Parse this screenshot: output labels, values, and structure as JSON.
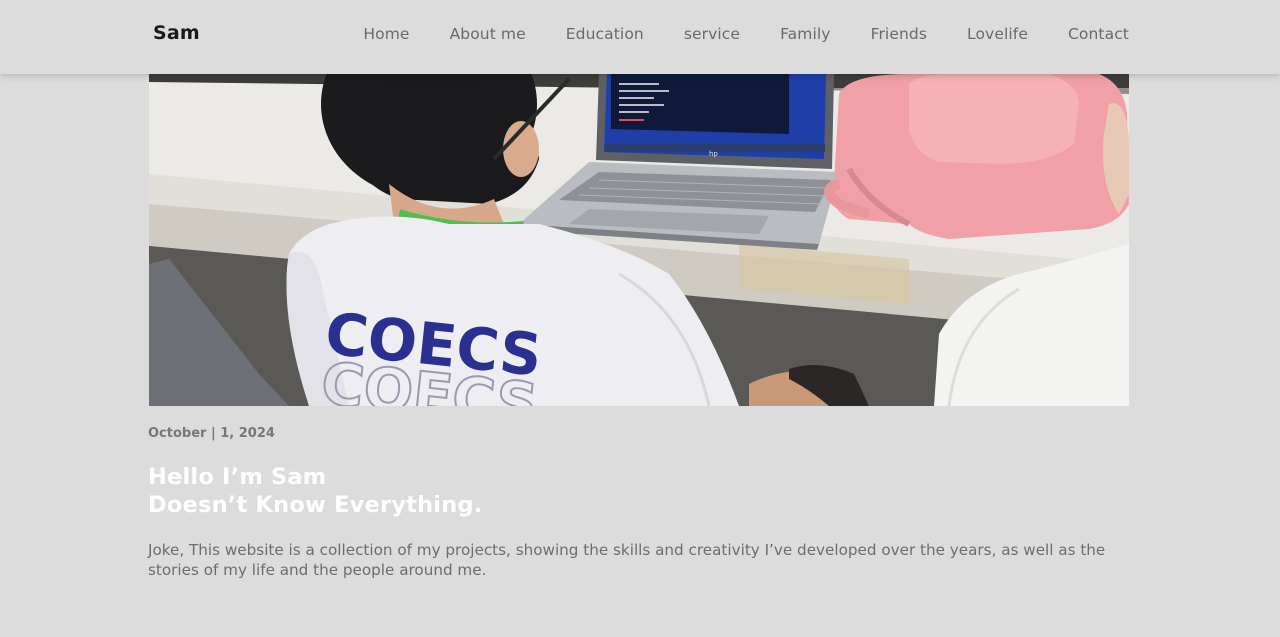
{
  "nav": {
    "brand": "Sam",
    "links": [
      {
        "label": "Home"
      },
      {
        "label": "About me"
      },
      {
        "label": "Education"
      },
      {
        "label": "service"
      },
      {
        "label": "Family"
      },
      {
        "label": "Friends"
      },
      {
        "label": "Lovelife"
      },
      {
        "label": "Contact"
      }
    ]
  },
  "hero": {
    "shirt_text": "COECS",
    "laptop_brand": "hp"
  },
  "post": {
    "date": "October | 1, 2024",
    "headline_line1": "Hello I’m Sam",
    "headline_line2": "Doesn’t Know Everything.",
    "intro": "Joke, This website is a collection of my projects, showing the skills and creativity I’ve developed over the years, as well as the stories of my life and the people around me."
  },
  "colors": {
    "background": "#dcdcdc",
    "brand": "#1a1a1a",
    "nav_link": "#6a6a6a",
    "headline": "#ffffff",
    "shirt_print": "#2b2f8f",
    "bag": "#f0a0a6"
  }
}
